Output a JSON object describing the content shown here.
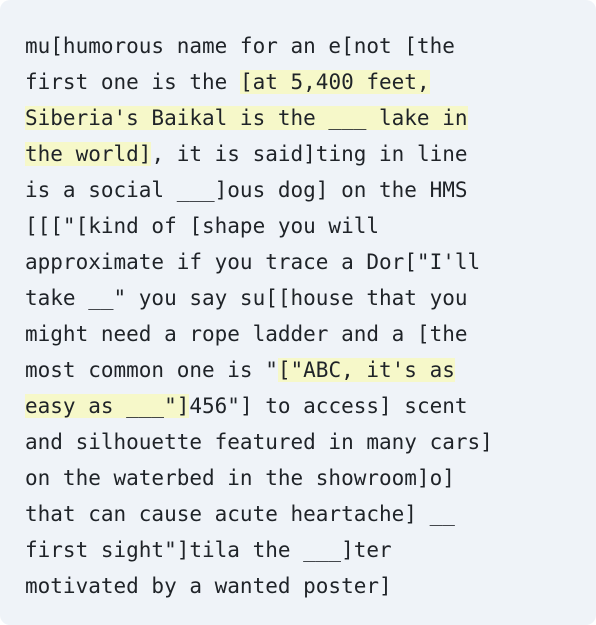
{
  "segments": [
    {
      "text": "mu[humorous name for an e[not [the\nfirst one is the ",
      "highlight": false
    },
    {
      "text": "[at 5,400 feet,\nSiberia's Baikal is the ___ lake in\nthe world]",
      "highlight": true
    },
    {
      "text": ", it is said]ting in line\nis a social ___]ous dog] on the HMS\n[[[\"[kind of [shape you will\napproximate if you trace a Dor[\"I'll\ntake __\" you say su[[house that you\nmight need a rope ladder and a [the\nmost common one is \"",
      "highlight": false
    },
    {
      "text": "[\"ABC, it's as\neasy as ___\"]",
      "highlight": true
    },
    {
      "text": "456\"] to access] scent\nand silhouette featured in many cars]\non the waterbed in the showroom]o]\nthat can cause acute heartache] __\nfirst sight\"]tila the ___]ter\nmotivated by a wanted poster]",
      "highlight": false
    }
  ]
}
